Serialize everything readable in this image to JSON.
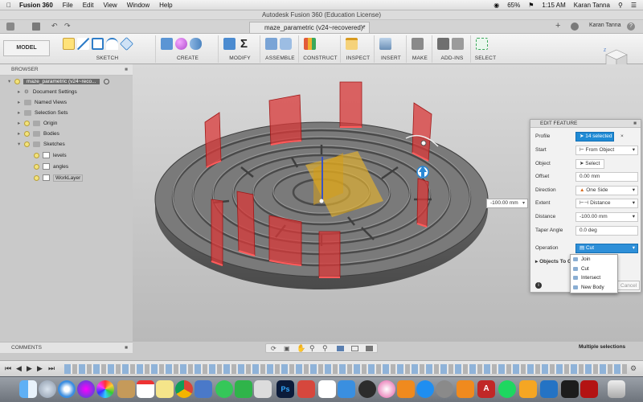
{
  "macbar": {
    "app": "Fusion 360",
    "menus": [
      "File",
      "Edit",
      "View",
      "Window",
      "Help"
    ],
    "battery": "65%",
    "time": "1:15 AM",
    "user": "Karan Tanna"
  },
  "window": {
    "title": "Autodesk Fusion 360 (Education License)"
  },
  "doc_tab": {
    "name": "maze_parametric (v24~recovered)*",
    "user": "Karan Tanna"
  },
  "ribbon": {
    "workspace": "MODEL",
    "groups": [
      "SKETCH",
      "CREATE",
      "MODIFY",
      "ASSEMBLE",
      "CONSTRUCT",
      "INSPECT",
      "INSERT",
      "MAKE",
      "ADD-INS",
      "SELECT"
    ]
  },
  "browser": {
    "title": "BROWSER",
    "root": "maze_parametric (v24~reco...",
    "items": [
      "Document Settings",
      "Named Views",
      "Selection Sets",
      "Origin",
      "Bodies",
      "Sketches"
    ],
    "sketches": [
      "levels",
      "angles",
      "WorkLayer"
    ]
  },
  "edit_feature": {
    "title": "EDIT FEATURE",
    "rows": [
      {
        "label": "Profile",
        "value": "14 selected"
      },
      {
        "label": "Start",
        "value": "From Object"
      },
      {
        "label": "Object",
        "value": "Select"
      },
      {
        "label": "Offset",
        "value": "0.00 mm"
      },
      {
        "label": "Direction",
        "value": "One Side"
      },
      {
        "label": "Extent",
        "value": "Distance"
      },
      {
        "label": "Distance",
        "value": "-100.00 mm"
      },
      {
        "label": "Taper Angle",
        "value": "0.0 deg"
      },
      {
        "label": "Operation",
        "value": "Cut"
      }
    ],
    "objects_to_cut": "Objects To C",
    "cancel": "Cancel",
    "operation_options": [
      "Join",
      "Cut",
      "Intersect",
      "New Body"
    ]
  },
  "canvas": {
    "distance_input": "-100.00 mm"
  },
  "comments": "COMMENTS",
  "status": "Multiple selections",
  "colors": {
    "accent": "#1f8ad4",
    "maze": "#6e6e6e",
    "wall": "#d93a3a",
    "plane": "#e6b32e"
  }
}
